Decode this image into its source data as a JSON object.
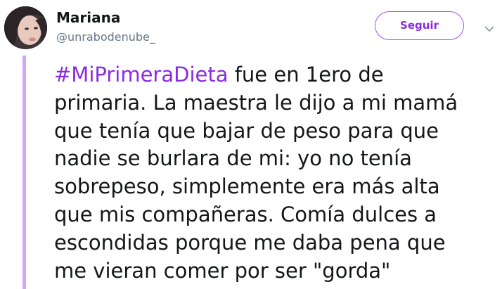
{
  "author": {
    "name": "Mariana",
    "handle": "@unrabodenube_"
  },
  "actions": {
    "follow_label": "Seguir",
    "menu_icon": "chevron-down-icon"
  },
  "tweet": {
    "hashtag": "#MiPrimeraDieta",
    "text_lines": [
      " fue en 1ero de",
      "primaria. La maestra le dijo a mi mamá",
      "que tenía que bajar de peso para que",
      "nadie se burlara de mi: yo no tenía",
      "sobrepeso, simplemente era más alta",
      "que mis compañeras. Comía dulces a",
      "escondidas porque me daba pena que",
      "me vieran comer por ser \"gorda\""
    ]
  },
  "colors": {
    "accent": "#8a2be2",
    "thread_line": "#d2a8f5",
    "text": "#14171a",
    "muted": "#657786"
  }
}
